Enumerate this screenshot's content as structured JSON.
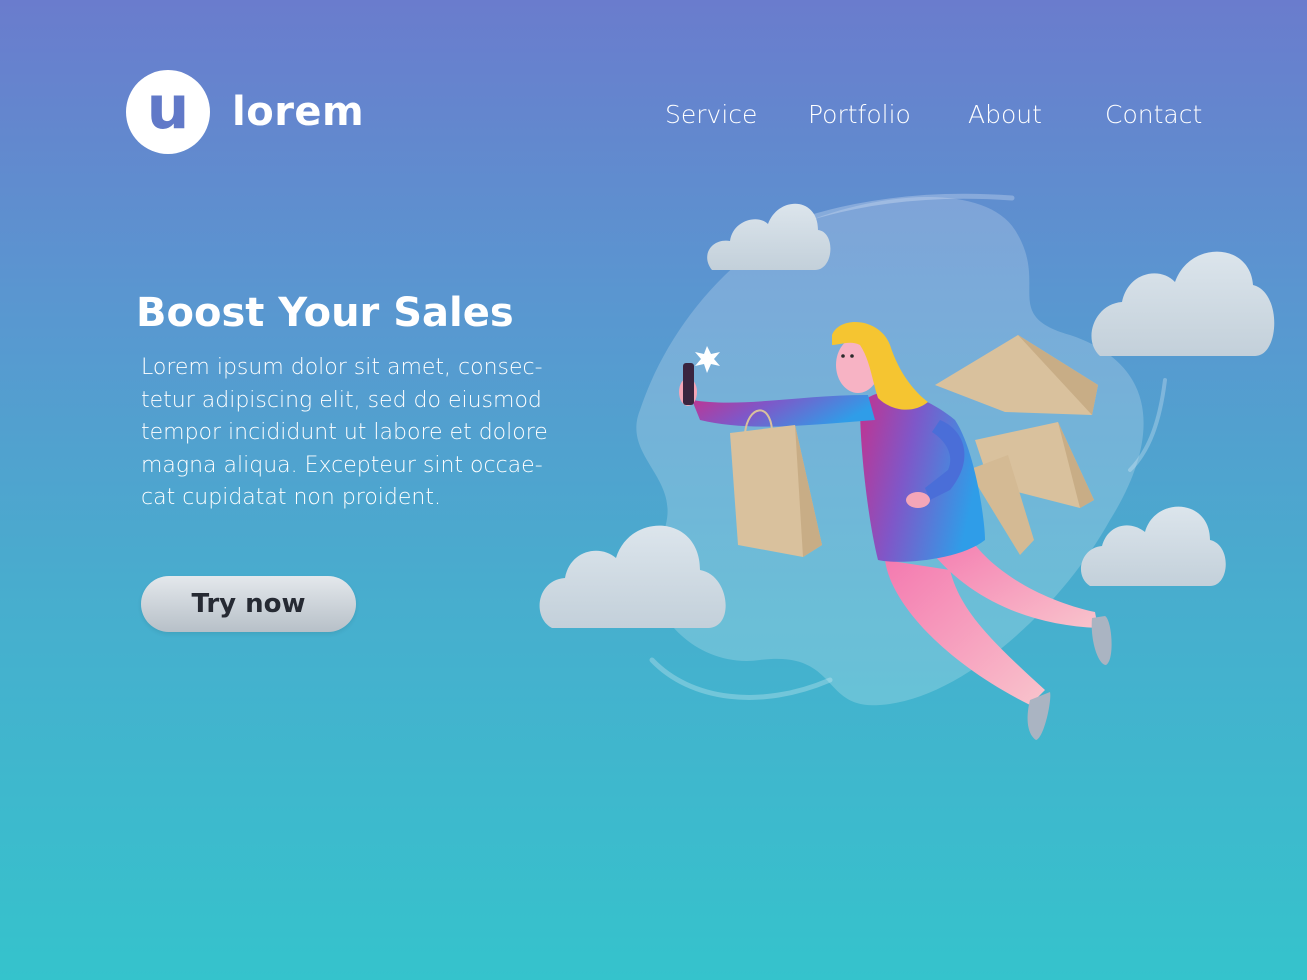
{
  "brand": {
    "logo_letter": "u",
    "name": "lorem"
  },
  "nav": {
    "items": [
      {
        "label": "Service"
      },
      {
        "label": "Portfolio"
      },
      {
        "label": "About"
      },
      {
        "label": "Contact"
      }
    ]
  },
  "hero": {
    "title": "Boost Your Sales",
    "body_lines": [
      "Lorem ipsum dolor sit amet, consec-",
      "tetur adipiscing elit, sed do eiusmod",
      "tempor incididunt ut labore et dolore",
      "magna aliqua. Excepteur sint occae-",
      "cat cupidatat non proident."
    ],
    "cta_label": "Try now"
  },
  "colors": {
    "background_top": "#6a7ccd",
    "background_bottom": "#35c3cc",
    "logo_accent": "#6179c8",
    "button_text": "#262a33",
    "hair": "#f5c531",
    "top_gradient_start": "#c2338f",
    "top_gradient_end": "#2f9de8",
    "pants": "#f58fb4",
    "shopping_bag": "#d9c19d",
    "cloud": "#cdd9e2"
  },
  "illustration": {
    "icons": [
      "woman-flying-icon",
      "phone-icon",
      "shopping-bag-icon",
      "cloud-icon",
      "sparkle-icon"
    ]
  }
}
